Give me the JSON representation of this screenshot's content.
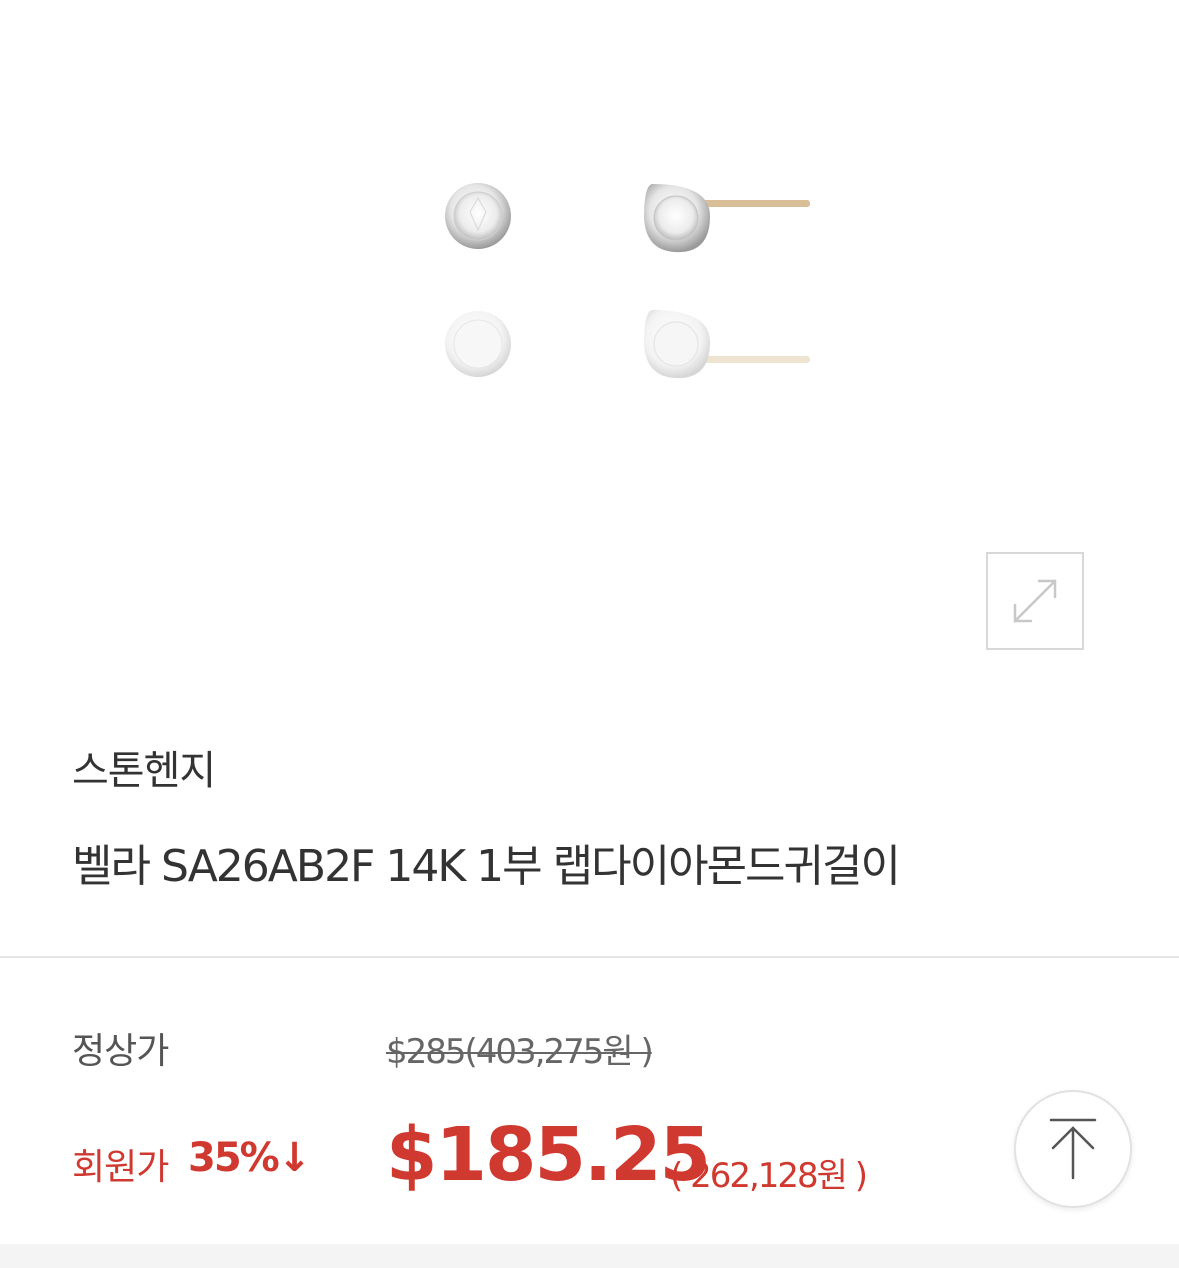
{
  "product": {
    "brand": "스톤헨지",
    "name": "벨라 SA26AB2F 14K 1부 랩다이아몬드귀걸이",
    "image_icon": "diamond-earrings-image"
  },
  "zoom": {
    "icon": "expand-arrows-icon"
  },
  "pricing": {
    "regular_label": "정상가",
    "regular_price": "$285(403,275원 )",
    "member_label": "회원가",
    "member_discount": "35%↓",
    "member_price": "$185.25",
    "member_price_krw": "( 262,128원 )"
  },
  "scroll_top": {
    "icon": "arrow-up-to-top-icon"
  },
  "colors": {
    "accent_red": "#d0392f",
    "text_dark": "#333333",
    "text_muted": "#666666",
    "divider": "#e6e6e6"
  }
}
